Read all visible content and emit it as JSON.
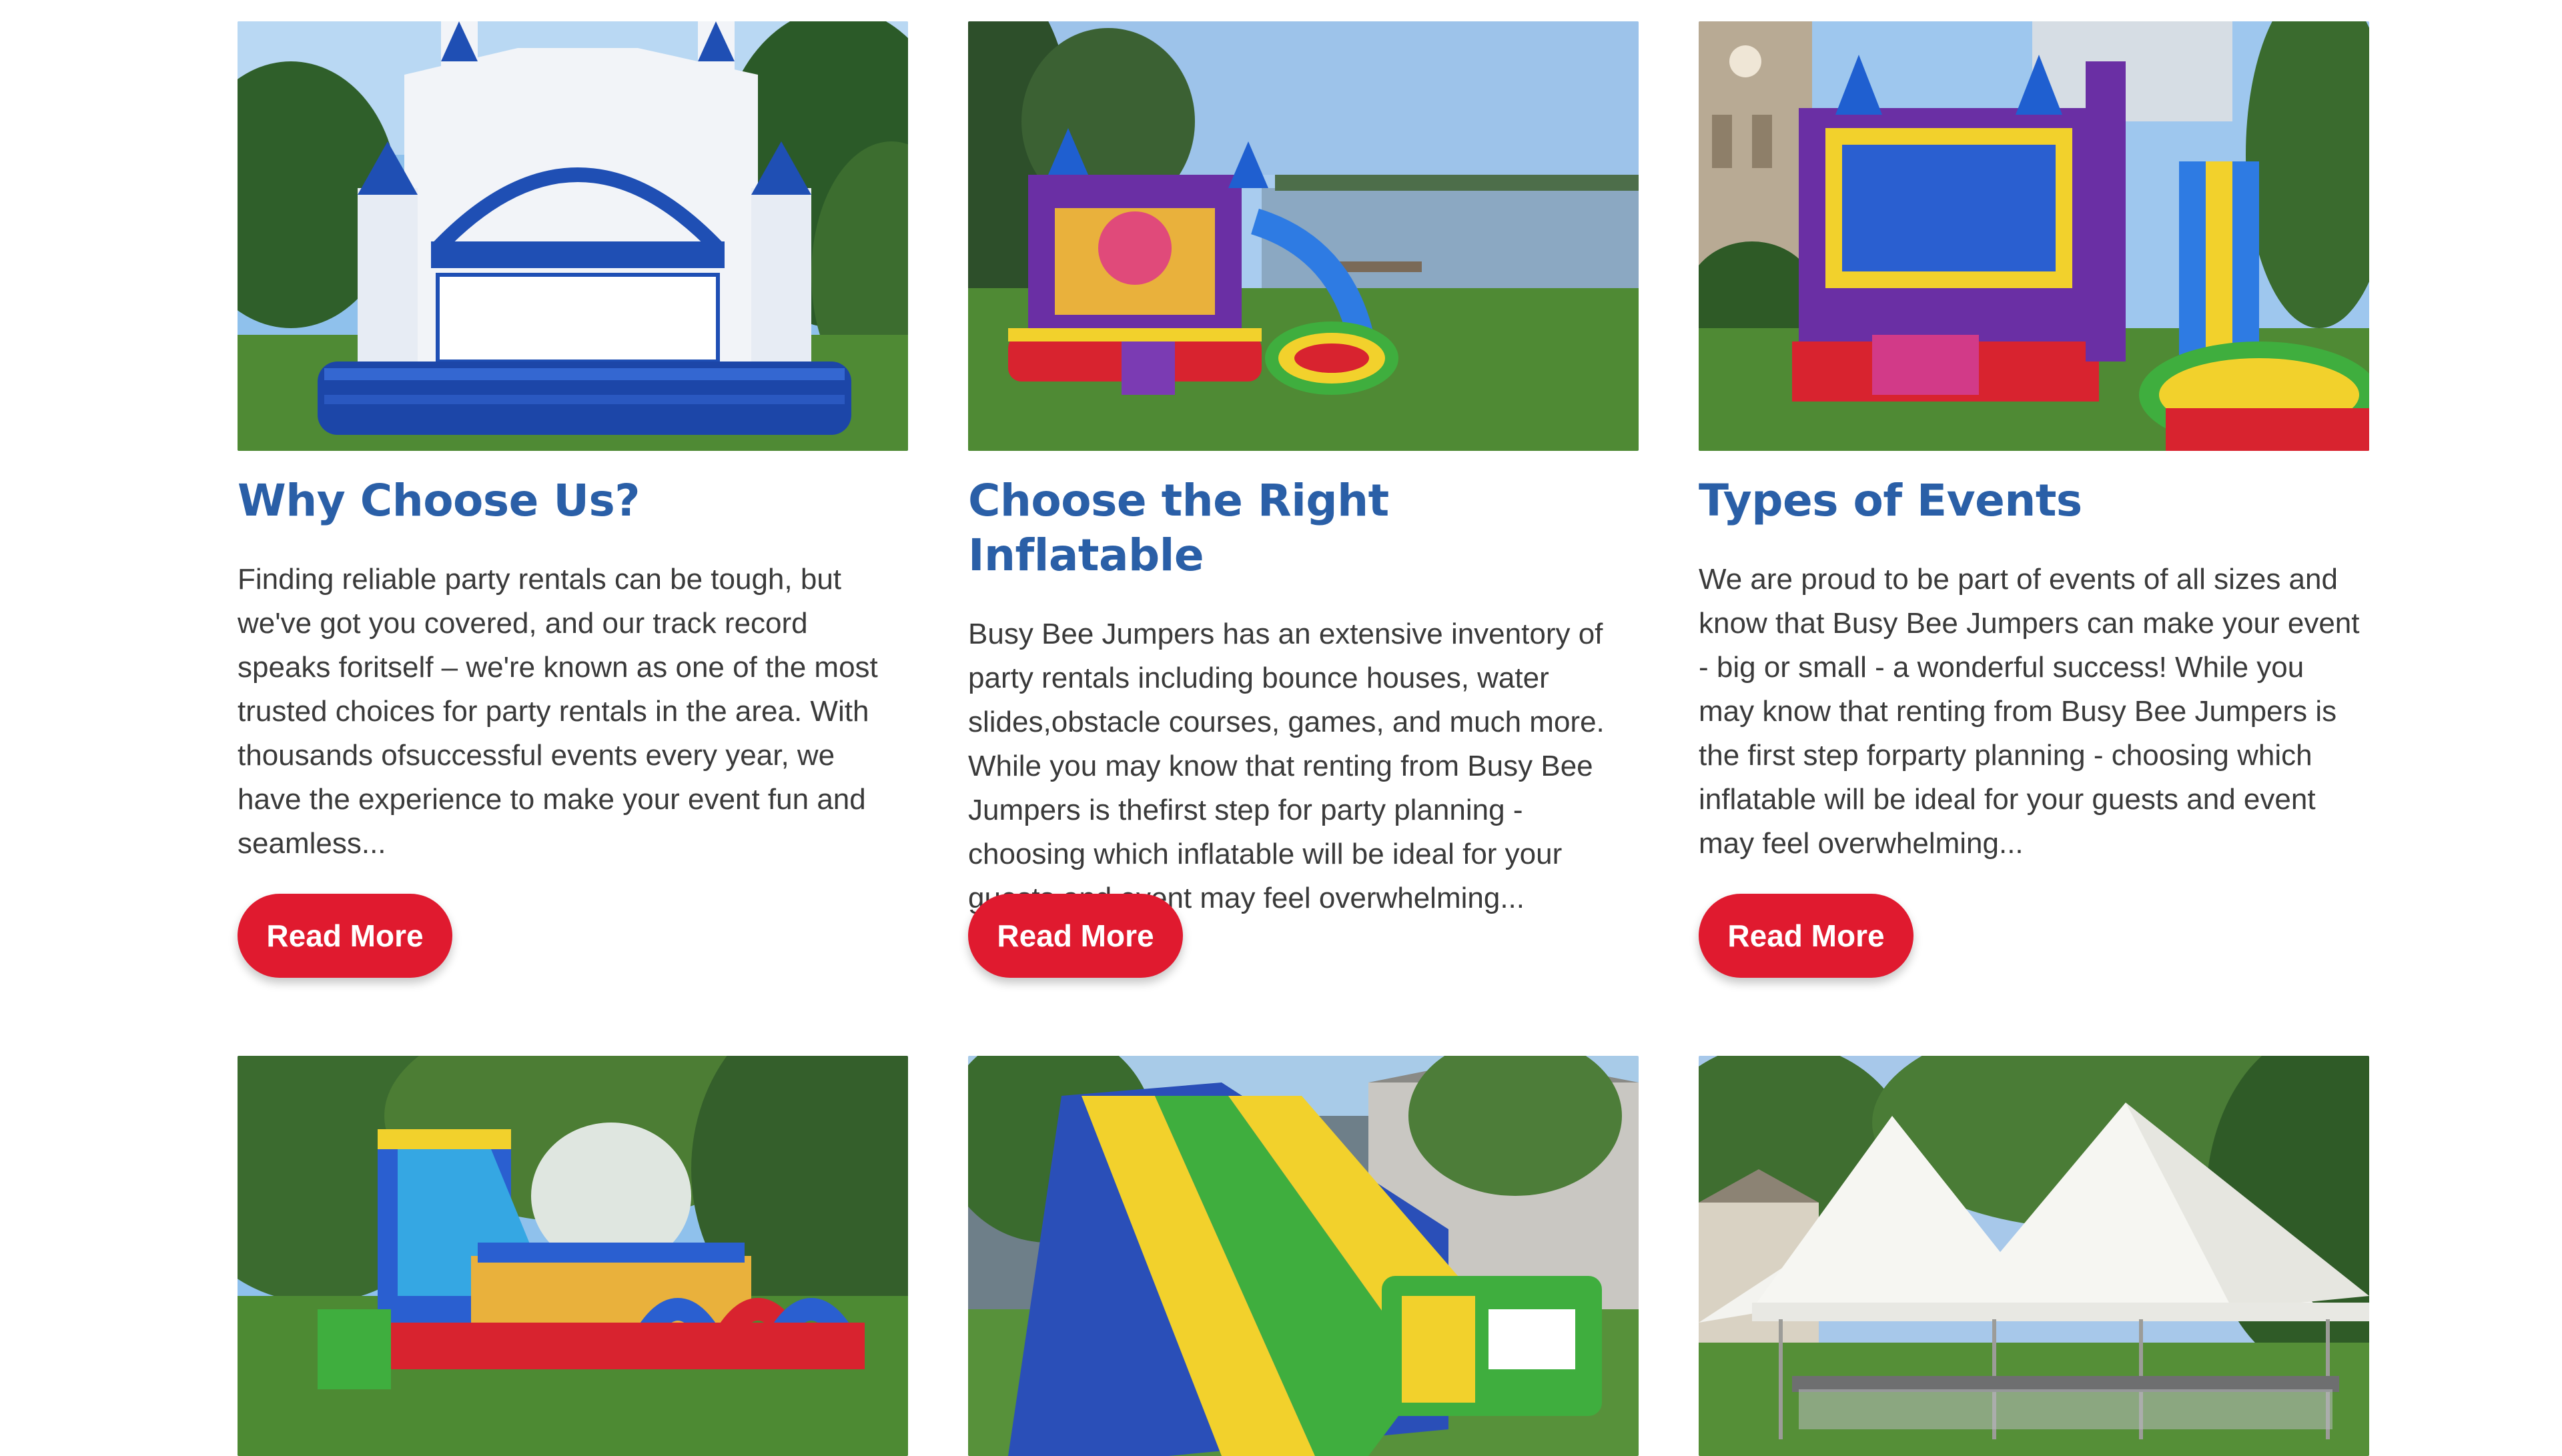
{
  "cards": [
    {
      "image_alt": "White and blue castle bounce house",
      "title": "Why Choose Us?",
      "text": "Finding reliable party rentals can be tough, but we've got you covered, and our track record speaks foritself – we're known as one of the most trusted choices for party rentals in the area. With thousands ofsuccessful events every year, we have the experience to make your event fun and seamless...",
      "button": "Read More"
    },
    {
      "image_alt": "Colorful bounce house with slide near a harbor",
      "title": "Choose the Right Inflatable",
      "text": "Busy Bee Jumpers has an extensive inventory of party rentals including bounce houses, water slides,obstacle courses, games, and much more. While you may know that renting from Busy Bee Jumpers is thefirst step for party planning - choosing which inflatable will be ideal for your guests and event may feel overwhelming...",
      "button": "Read More"
    },
    {
      "image_alt": "Castle bounce house combo with slide in a city park",
      "title": "Types of Events",
      "text": "We are proud to be part of events of all sizes and know that Busy Bee Jumpers can make your event - big or small - a wonderful success! While you may know that renting from Busy Bee Jumpers is the first step forparty planning - choosing which inflatable will be ideal for your guests and event may feel overwhelming...",
      "button": "Read More"
    }
  ],
  "row2_images": [
    {
      "image_alt": "Inflatable obstacle course with arches"
    },
    {
      "image_alt": "Green and yellow inflatable water slide"
    },
    {
      "image_alt": "White peaked party tents with tables and chairs"
    }
  ],
  "colors": {
    "title": "#2a5fa7",
    "button": "#e01a2f",
    "body_text": "#3a3a3a"
  }
}
